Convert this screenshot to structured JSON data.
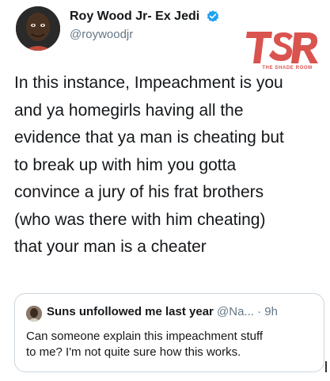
{
  "author": {
    "display_name": "Roy Wood Jr- Ex Jedi",
    "handle": "@roywoodjr",
    "verified_icon": "verified-badge-icon",
    "avatar_icon": "profile-photo"
  },
  "watermark": {
    "logo_text": "TSR",
    "tagline": "THE SHADE ROOM",
    "color": "#d9534f"
  },
  "tweet": {
    "lines": [
      "In this instance, Impeachment is you",
      "and ya homegirls having all the",
      "evidence that ya man is cheating but",
      "to break up with him you gotta",
      "convince a jury of his frat brothers",
      "(who was there with him cheating)",
      "that your man is a cheater"
    ]
  },
  "quote": {
    "name": "Suns unfollowed me last year",
    "handle_time": " @Na... · 9h",
    "lines": [
      "Can someone explain this impeachment stuff",
      "to me? I'm not quite sure how this works."
    ]
  },
  "colors": {
    "verified": "#1da1f2",
    "secondary_text": "#657786",
    "border": "#ccd6dd"
  }
}
